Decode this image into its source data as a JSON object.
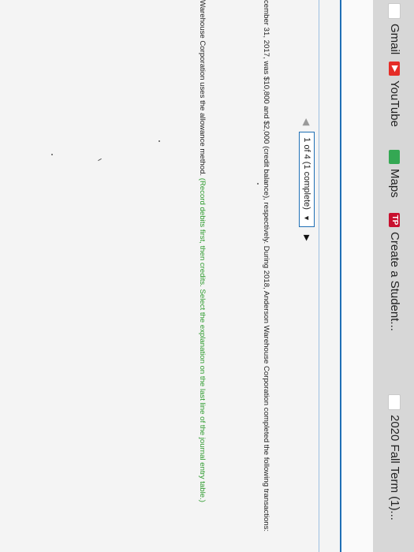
{
  "bookmarks": [
    {
      "label": "Gmail",
      "icon": "gmail-icon"
    },
    {
      "label": "YouTube",
      "icon": "youtube-icon"
    },
    {
      "label": "Maps",
      "icon": "maps-icon"
    },
    {
      "label": "Create a Student...",
      "icon": "tp-icon",
      "icon_text": "TP"
    },
    {
      "label": "2020 Fall Term (1)...",
      "icon": "gmail-icon"
    }
  ],
  "nav": {
    "progress_text": "1 of 4 (1 complete)",
    "prev_glyph": "◀",
    "next_glyph": "▶",
    "dropdown_glyph": "▼"
  },
  "question": {
    "line1": "cember 31, 2017, was $10,800 and $2,000 (credit balance), respectively. During 2018, Anderson Warehouse Corporation completed the following transactions:",
    "line2_plain": "Warehouse Corporation uses the allowance method.",
    "line2_green": "(Record debits first, then credits. Select the explanation on the last line of the journal entry table.)"
  },
  "colors": {
    "accent": "#1f6fb5",
    "green_text": "#2e9b2e"
  }
}
